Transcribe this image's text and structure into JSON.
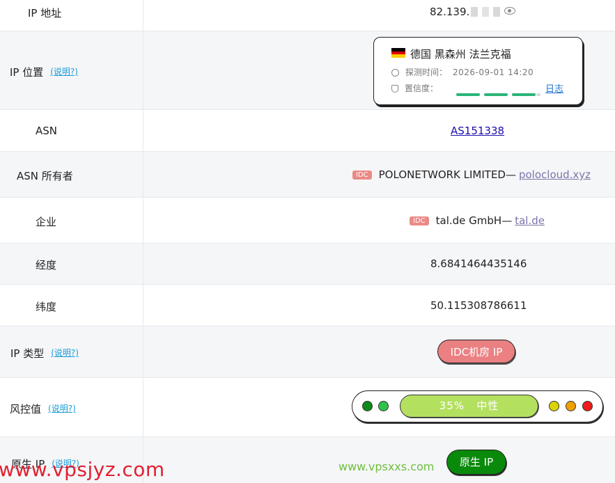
{
  "rows": {
    "ip_address": {
      "label": "IP 地址",
      "value": "82.139."
    },
    "ip_location": {
      "label": "IP 位置",
      "help": "(说明?)",
      "country": "德国",
      "region": "黑森州",
      "city": "法兰克福",
      "detect_time_label": "探测时间：",
      "detect_time": "2026-09-01 14:20",
      "confidence_label": "置信度：",
      "confidence_level": 0.9,
      "log_link": "日志",
      "flag_colors": [
        "#000000",
        "#dd0000",
        "#ffce00"
      ]
    },
    "asn": {
      "label": "ASN",
      "value": "AS151338"
    },
    "asn_owner": {
      "label": "ASN 所有者",
      "tag": "IDC",
      "name": "POLONETWORK LIMITED—",
      "domain": "polocloud.xyz"
    },
    "company": {
      "label": "企业",
      "tag": "IDC",
      "name": "tal.de GmbH—",
      "domain": "tal.de"
    },
    "longitude": {
      "label": "经度",
      "value": "8.6841464435146"
    },
    "latitude": {
      "label": "纬度",
      "value": "50.115308786611"
    },
    "ip_type": {
      "label": "IP 类型",
      "help": "(说明?)",
      "value": "IDC机房 IP"
    },
    "risk": {
      "label": "风控值",
      "help": "(说明?)",
      "percent_text": "35%",
      "level_text": "中性",
      "percent": 35
    },
    "native_ip": {
      "label": "原生 IP",
      "help": "(说明?)",
      "value": "原生 IP"
    }
  },
  "watermarks": {
    "red": "www.vpsjyz.com",
    "green": "www.vpsxxs.com"
  },
  "colors": {
    "idc_red": "#ea8082",
    "risk_green": "#b4e060",
    "native_green": "#0a8a0a",
    "confidence": "#2bb57a"
  },
  "icons": [
    "eye-icon",
    "clock-icon",
    "shield-icon",
    "flag-germany-icon"
  ]
}
